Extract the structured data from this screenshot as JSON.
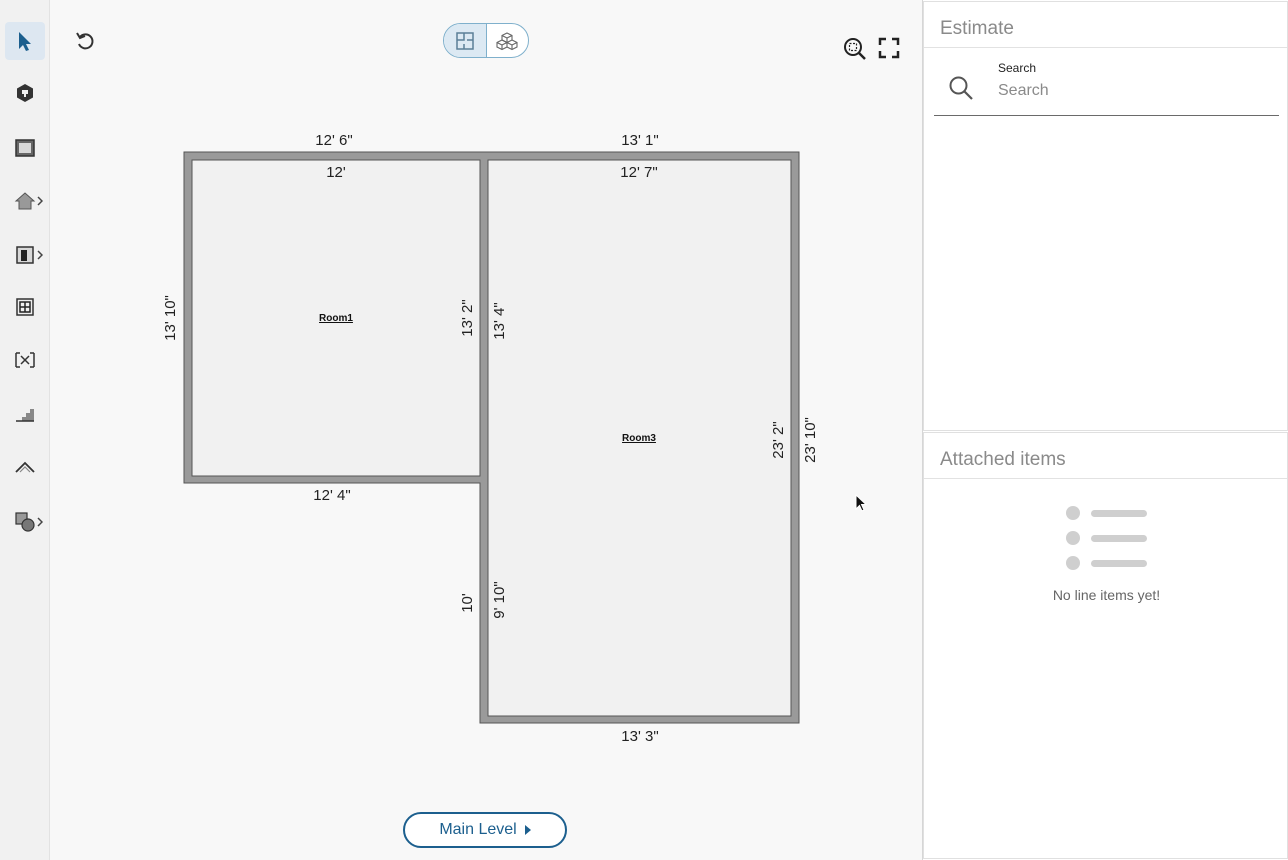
{
  "toolbar": {
    "tools": [
      {
        "icon": "select-pointer-icon",
        "active": true
      },
      {
        "icon": "object-3d-icon"
      },
      {
        "icon": "room-icon"
      },
      {
        "icon": "house-icon",
        "submenu": true
      },
      {
        "icon": "door-icon",
        "submenu": true
      },
      {
        "icon": "window-icon"
      },
      {
        "icon": "opening-icon"
      },
      {
        "icon": "stairs-icon"
      },
      {
        "icon": "roof-icon"
      },
      {
        "icon": "shapes-icon",
        "submenu": true
      }
    ]
  },
  "canvas": {
    "undo_icon": "undo-icon",
    "view_modes": [
      "floor-plan-2d-icon",
      "view-3d-icon"
    ],
    "zoom_icon": "zoom-fit-icon",
    "fullscreen_icon": "fullscreen-icon",
    "level_label": "Main Level"
  },
  "floor_plan": {
    "rooms": [
      {
        "name": "Room1"
      },
      {
        "name": "Room3"
      }
    ],
    "dimensions": {
      "room1_outer_top": "12' 6\"",
      "room1_inner_top": "12'",
      "room1_outer_left": "13' 10\"",
      "room1_inner_right": "13' 2\"",
      "room1_outer_bottom": "12' 4\"",
      "room3_outer_top": "13' 1\"",
      "room3_inner_top": "12' 7\"",
      "room3_inner_left_upper": "13' 4\"",
      "room3_inner_left_lower": "9' 10\"",
      "room3_outer_left_lower": "10'",
      "room3_inner_right": "23' 2\"",
      "room3_outer_right": "23' 10\"",
      "room3_outer_bottom": "13' 3\""
    }
  },
  "estimate": {
    "title": "Estimate",
    "search_label": "Search",
    "search_placeholder": "Search"
  },
  "attached": {
    "title": "Attached items",
    "empty_text": "No line items yet!"
  },
  "colors": {
    "accent": "#1c5f8e",
    "wall": "#9a9a9a",
    "room_fill": "#f1f1f1"
  }
}
